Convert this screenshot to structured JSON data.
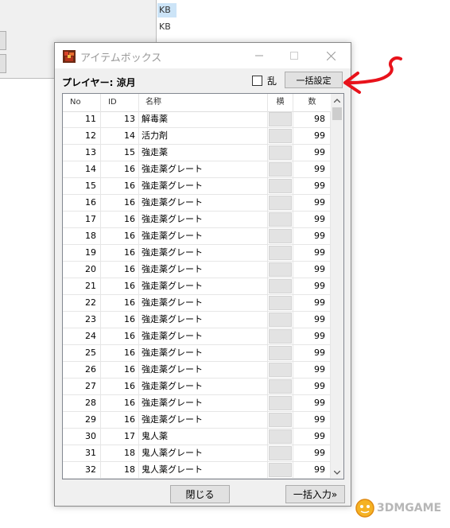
{
  "background": {
    "size_labels": [
      "KB",
      "KB"
    ]
  },
  "dialog": {
    "title": "アイテムボックス",
    "player_label": "プレイヤー: 涼月",
    "random_checkbox_label": "乱",
    "random_checked": false,
    "bulk_set_label": "一括設定",
    "close_label": "閉じる",
    "bulk_input_label": "一括入力»",
    "columns": [
      "No",
      "ID",
      "名称",
      "横",
      "数"
    ],
    "rows": [
      {
        "no": "11",
        "id": "13",
        "name": "解毒薬",
        "qty": "98"
      },
      {
        "no": "12",
        "id": "14",
        "name": "活力剤",
        "qty": "99"
      },
      {
        "no": "13",
        "id": "15",
        "name": "強走薬",
        "qty": "99"
      },
      {
        "no": "14",
        "id": "16",
        "name": "強走薬グレート",
        "qty": "99"
      },
      {
        "no": "15",
        "id": "16",
        "name": "強走薬グレート",
        "qty": "99"
      },
      {
        "no": "16",
        "id": "16",
        "name": "強走薬グレート",
        "qty": "99"
      },
      {
        "no": "17",
        "id": "16",
        "name": "強走薬グレート",
        "qty": "99"
      },
      {
        "no": "18",
        "id": "16",
        "name": "強走薬グレート",
        "qty": "99"
      },
      {
        "no": "19",
        "id": "16",
        "name": "強走薬グレート",
        "qty": "99"
      },
      {
        "no": "20",
        "id": "16",
        "name": "強走薬グレート",
        "qty": "99"
      },
      {
        "no": "21",
        "id": "16",
        "name": "強走薬グレート",
        "qty": "99"
      },
      {
        "no": "22",
        "id": "16",
        "name": "強走薬グレート",
        "qty": "99"
      },
      {
        "no": "23",
        "id": "16",
        "name": "強走薬グレート",
        "qty": "99"
      },
      {
        "no": "24",
        "id": "16",
        "name": "強走薬グレート",
        "qty": "99"
      },
      {
        "no": "25",
        "id": "16",
        "name": "強走薬グレート",
        "qty": "99"
      },
      {
        "no": "26",
        "id": "16",
        "name": "強走薬グレート",
        "qty": "99"
      },
      {
        "no": "27",
        "id": "16",
        "name": "強走薬グレート",
        "qty": "99"
      },
      {
        "no": "28",
        "id": "16",
        "name": "強走薬グレート",
        "qty": "99"
      },
      {
        "no": "29",
        "id": "16",
        "name": "強走薬グレート",
        "qty": "99"
      },
      {
        "no": "30",
        "id": "17",
        "name": "鬼人薬",
        "qty": "99"
      },
      {
        "no": "31",
        "id": "18",
        "name": "鬼人薬グレート",
        "qty": "99"
      },
      {
        "no": "32",
        "id": "18",
        "name": "鬼人薬グレート",
        "qty": "99"
      }
    ]
  },
  "annotation": {
    "color": "#e8121b",
    "icon": "red-arrow"
  },
  "watermark": {
    "text": "3DMGAME",
    "icon": "3dm-logo"
  },
  "colors": {
    "window_bg": "#f0f0f0",
    "button_bg": "#e1e1e1",
    "button_border": "#adadad"
  }
}
